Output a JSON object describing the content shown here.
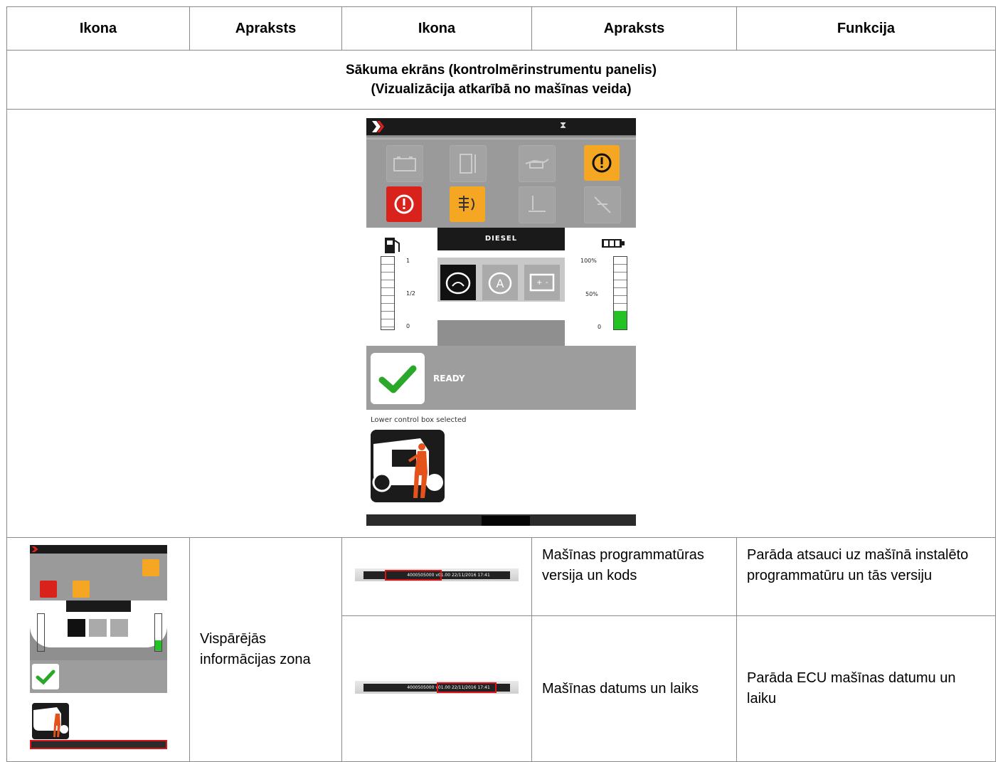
{
  "table": {
    "headers": [
      "Ikona",
      "Apraksts",
      "Ikona",
      "Apraksts",
      "Funkcija"
    ],
    "section_title_line1": "Sākuma ekrāns (kontrolmērinstrumentu panelis)",
    "section_title_line2": "(Vizualizācija atkarībā no mašīnas veida)",
    "row_zone_description": "Vispārējās informācijas zona",
    "rows": [
      {
        "description": "Mašīnas programmatūras versija un kods",
        "function": "Parāda atsauci uz mašīnā instalēto programmatūru un tās versiju"
      },
      {
        "description": "Mašīnas datums un laiks",
        "function": "Parāda  ECU mašīnas datumu un laiku"
      }
    ]
  },
  "dashboard": {
    "fuel_label": "DIESEL",
    "fuel_ticks": [
      "1",
      "1/2",
      "0"
    ],
    "battery_ticks": [
      "100%",
      "50%",
      "0"
    ],
    "battery_level_percent": 25,
    "status_text": "READY",
    "control_box_text": "Lower control box selected",
    "warning_icons": [
      {
        "name": "battery-charge-icon",
        "state": "off"
      },
      {
        "name": "coolant-temperature-icon",
        "state": "off"
      },
      {
        "name": "oil-pressure-icon",
        "state": "off"
      },
      {
        "name": "engine-warning-icon",
        "state": "amber"
      },
      {
        "name": "engine-alarm-icon",
        "state": "red"
      },
      {
        "name": "air-filter-icon",
        "state": "amber"
      },
      {
        "name": "water-in-fuel-icon",
        "state": "off"
      },
      {
        "name": "glow-plug-icon",
        "state": "off"
      }
    ],
    "colors": {
      "amber": "#f5a623",
      "red": "#d9221c",
      "ready_green": "#2aa82a",
      "battery_green": "#22c322"
    }
  },
  "strip": {
    "software_code": "4000505000",
    "software_version": "v01.00",
    "datetime": "22/11/2016 17:41"
  }
}
